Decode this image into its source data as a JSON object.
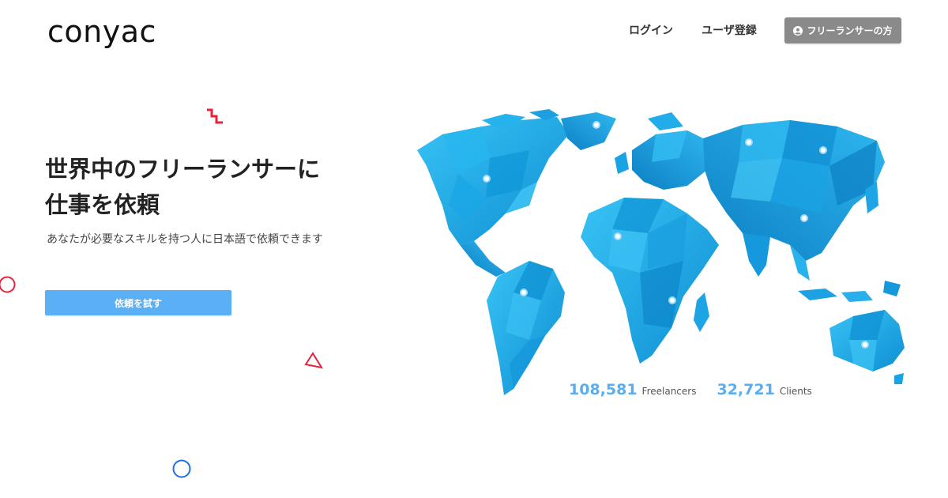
{
  "header": {
    "logo_text": "conyac",
    "nav": {
      "login_label": "ログイン",
      "register_label": "ユーザ登録",
      "freelancer_label": "フリーランサーの方",
      "freelancer_icon": "user-circle-icon"
    }
  },
  "hero": {
    "title_line1": "世界中のフリーランサーに",
    "title_line2": "仕事を依頼",
    "subtitle": "あなたが必要なスキルを持つ人に日本語で依頼できます",
    "cta_label": "依頼を試す"
  },
  "stats": {
    "freelancers_count": "108,581",
    "freelancers_label": "Freelancers",
    "clients_count": "32,721",
    "clients_label": "Clients"
  },
  "colors": {
    "accent_blue": "#5bb0f5",
    "map_blue": "#1ca9e8",
    "nav_button_gray": "#8a8a8a",
    "deco_red": "#e8213a",
    "deco_blue": "#1e6fe0"
  },
  "decorations": [
    "zigzag-shape",
    "red-circle-outline",
    "red-triangle-outline",
    "blue-circle-outline"
  ]
}
